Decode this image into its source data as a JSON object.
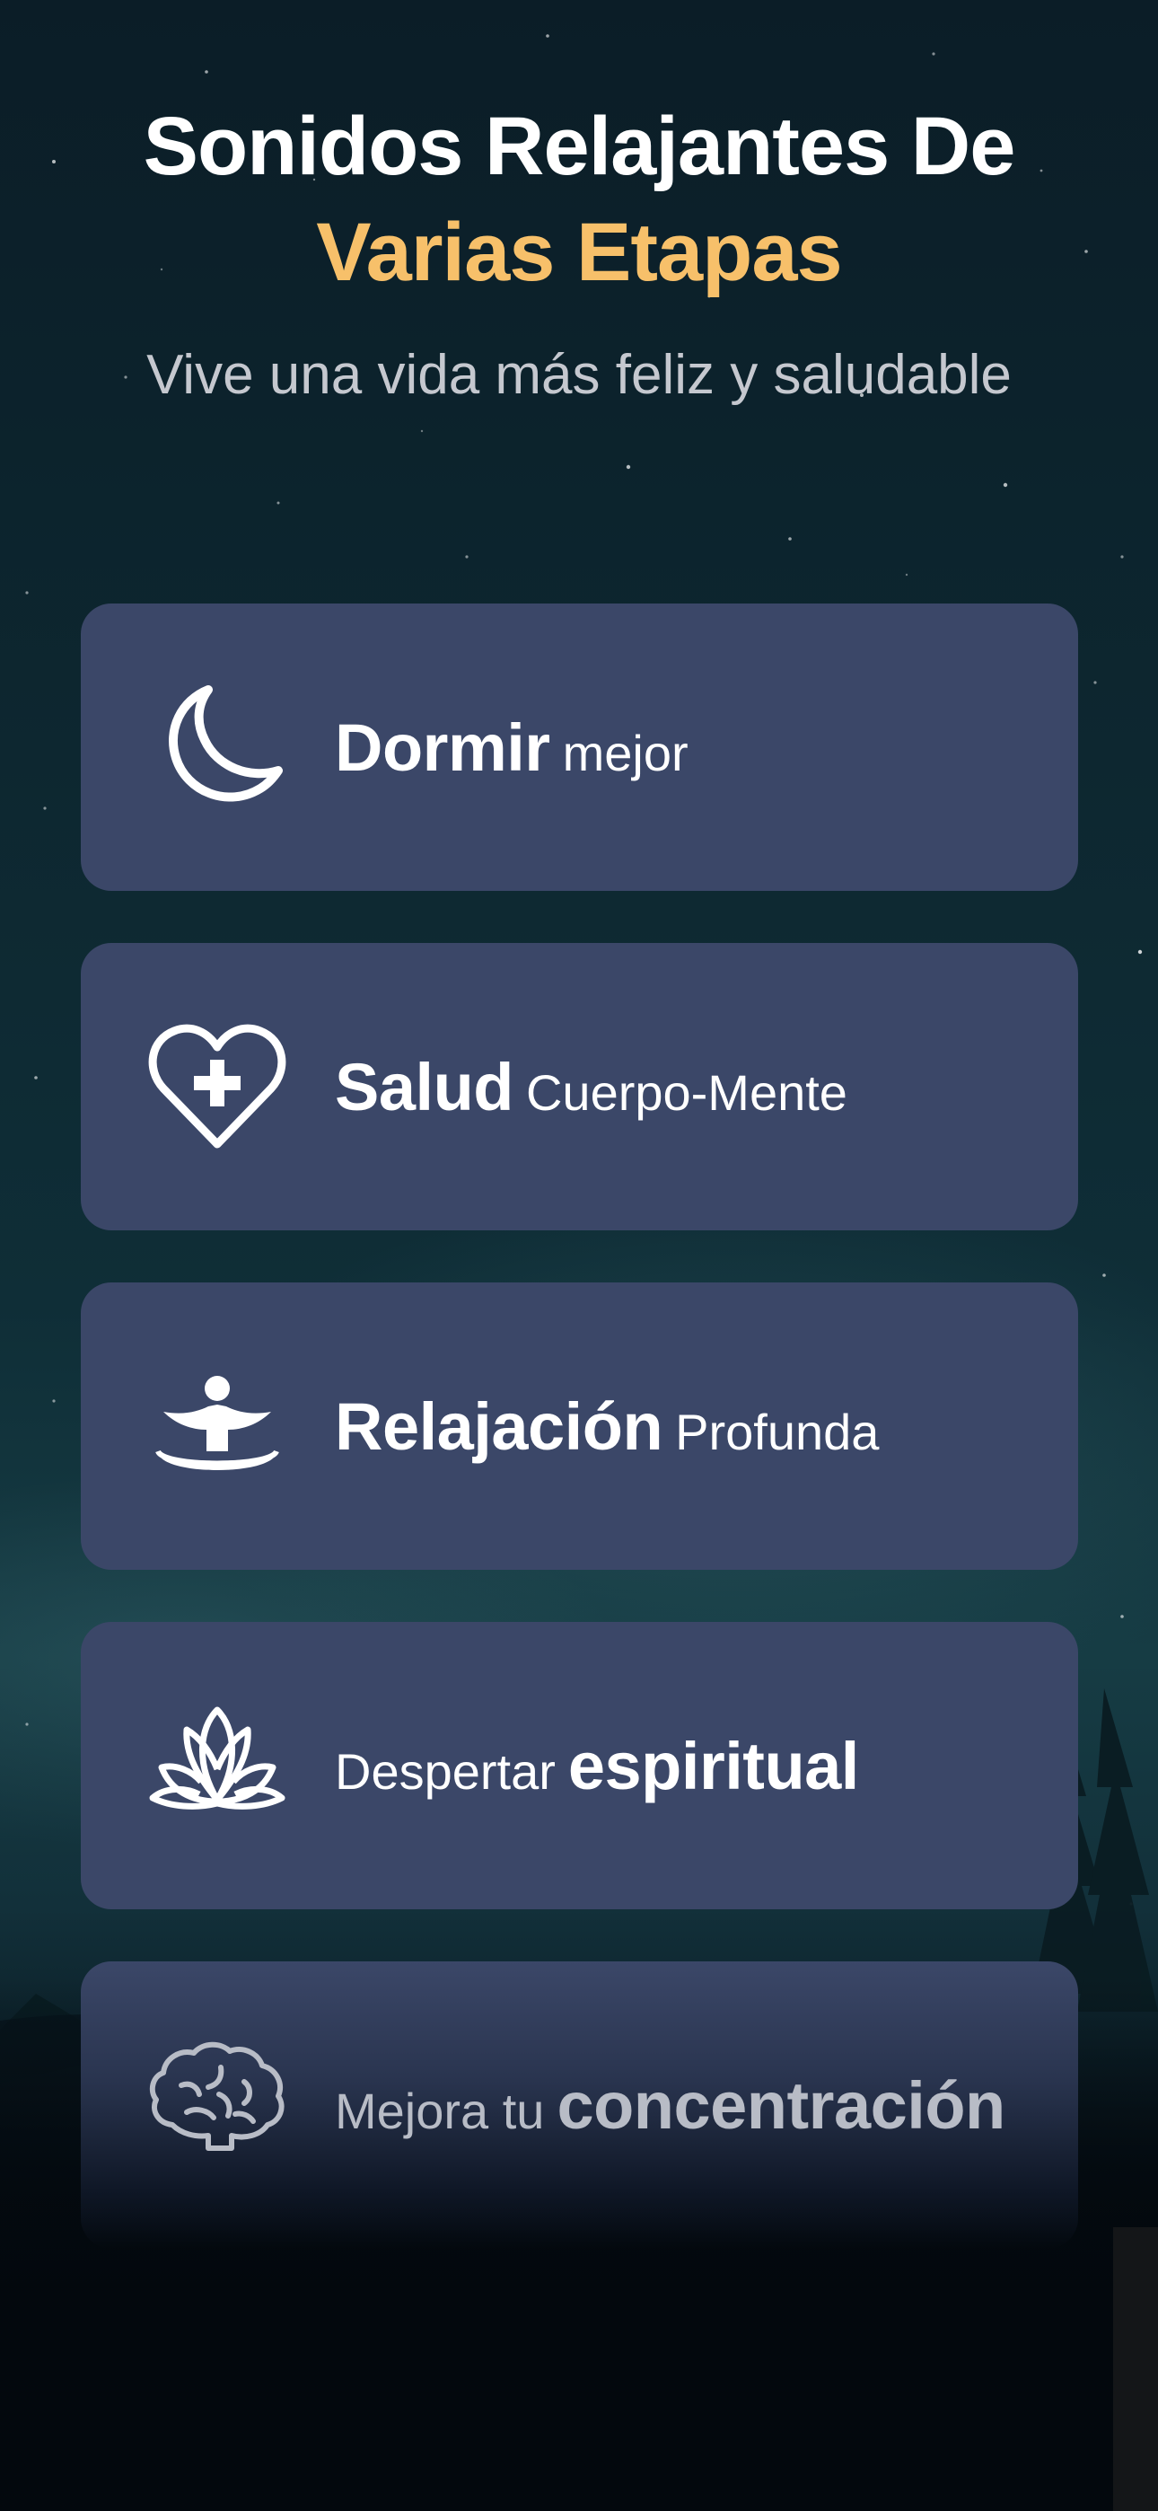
{
  "header": {
    "title_line1": "Sonidos Relajantes De",
    "title_line2": "Varias Etapas",
    "subtitle": "Vive una vida más feliz y saludable"
  },
  "categories": [
    {
      "icon": "moon-icon",
      "bold": "Dormir",
      "regular": "mejor",
      "bold_first": true
    },
    {
      "icon": "heart-plus-icon",
      "bold": "Salud",
      "regular": "Cuerpo-Mente",
      "bold_first": true
    },
    {
      "icon": "meditation-person-icon",
      "bold": "Relajación",
      "regular": "Profunda",
      "bold_first": true
    },
    {
      "icon": "lotus-icon",
      "bold": "espiritual",
      "regular": "Despertar",
      "bold_first": false
    },
    {
      "icon": "brain-icon",
      "bold": "concentración",
      "regular": "Mejora tu",
      "bold_first": false
    }
  ],
  "colors": {
    "accent": "#f7c06a",
    "card_background": "#3b4768",
    "text": "#ffffff",
    "subtitle": "#c5c8cf"
  }
}
